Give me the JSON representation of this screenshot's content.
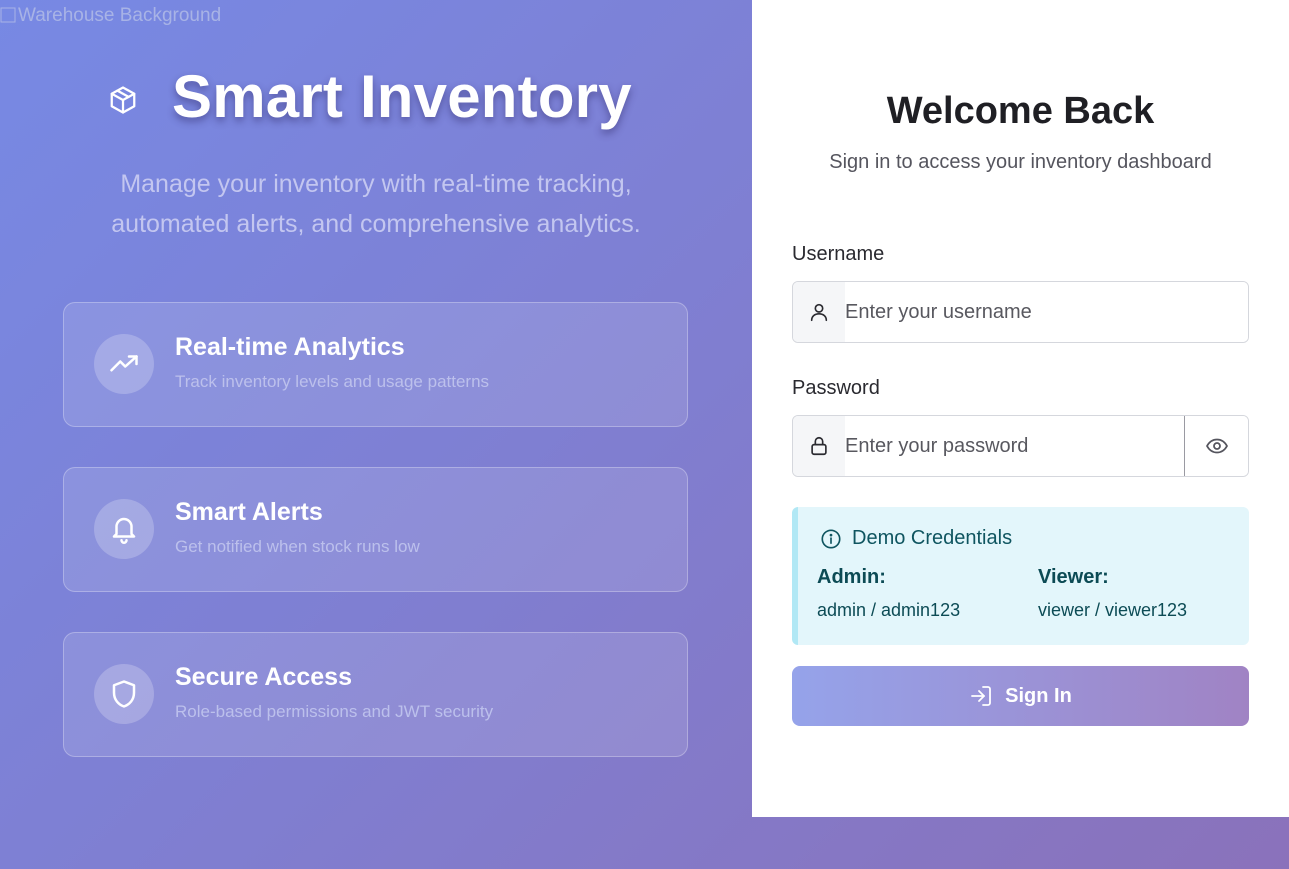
{
  "background": {
    "broken_image_alt": "Warehouse Background"
  },
  "hero": {
    "title": "Smart Inventory",
    "logo_icon": "package-cube-icon",
    "subtitle_line1": "Manage your inventory with real-time tracking,",
    "subtitle_line2": "automated alerts, and comprehensive analytics."
  },
  "features": [
    {
      "icon": "trending-up-icon",
      "title": "Real-time Analytics",
      "description": "Track inventory levels and usage patterns"
    },
    {
      "icon": "bell-icon",
      "title": "Smart Alerts",
      "description": "Get notified when stock runs low"
    },
    {
      "icon": "shield-icon",
      "title": "Secure Access",
      "description": "Role-based permissions and JWT security"
    }
  ],
  "login": {
    "title": "Welcome Back",
    "subtitle": "Sign in to access your inventory dashboard",
    "username": {
      "label": "Username",
      "placeholder": "Enter your username",
      "value": "",
      "icon": "user-icon"
    },
    "password": {
      "label": "Password",
      "placeholder": "Enter your password",
      "value": "",
      "icon": "lock-icon",
      "toggle_icon": "eye-icon"
    },
    "demo": {
      "icon": "info-circle-icon",
      "title": "Demo Credentials",
      "admin_label": "Admin:",
      "admin_value": "admin / admin123",
      "viewer_label": "Viewer:",
      "viewer_value": "viewer / viewer123"
    },
    "submit": {
      "label": "Sign In",
      "icon": "sign-in-icon"
    }
  },
  "colors": {
    "gradient_start": "#7789e4",
    "gradient_end": "#8a72bb",
    "demo_bg": "#e3f6fb",
    "demo_text": "#0c4b55",
    "button_start": "#95a3ea",
    "button_end": "#a083c4"
  }
}
